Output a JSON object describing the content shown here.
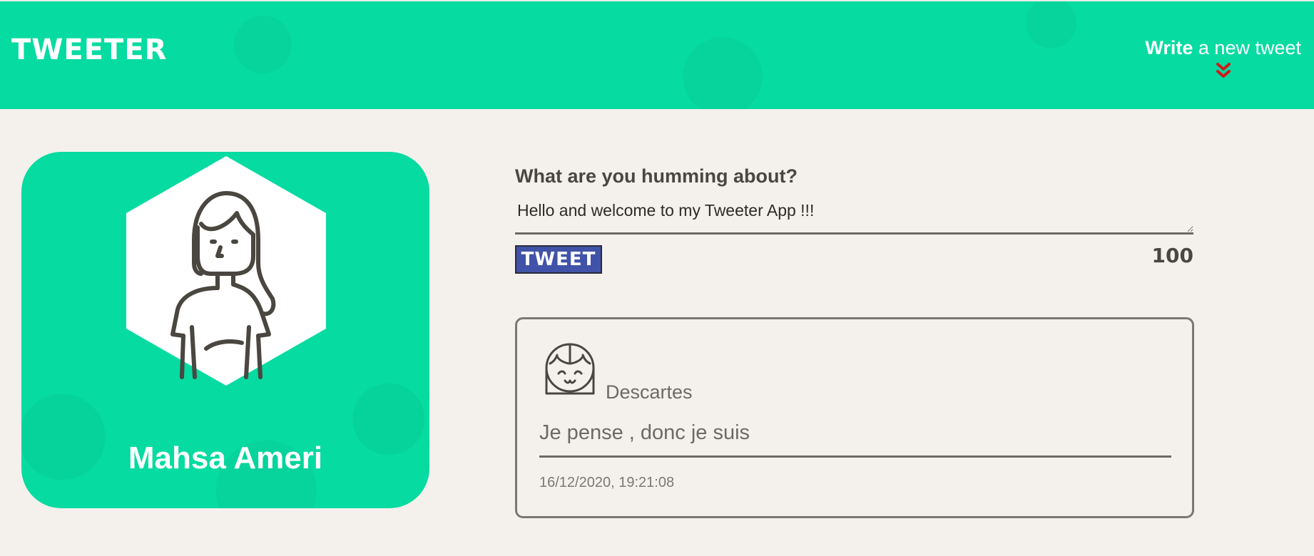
{
  "header": {
    "brand": "TWEETER",
    "write_bold": "Write",
    "write_rest": " a new tweet",
    "chevron_icon": "double-chevron-down-icon",
    "accent_color": "#06dba1",
    "chevron_color": "#d11a1a"
  },
  "profile": {
    "name": "Mahsa Ameri",
    "avatar_icon": "woman-avatar-icon"
  },
  "compose": {
    "label": "What are you humming about?",
    "value": "Hello and welcome to my Tweeter App !!!",
    "button_label": "TWEET",
    "counter": "100"
  },
  "tweets": [
    {
      "author": "Descartes",
      "avatar_icon": "girl-avatar-icon",
      "text": "Je pense , donc je suis",
      "timestamp": "16/12/2020, 19:21:08"
    }
  ]
}
